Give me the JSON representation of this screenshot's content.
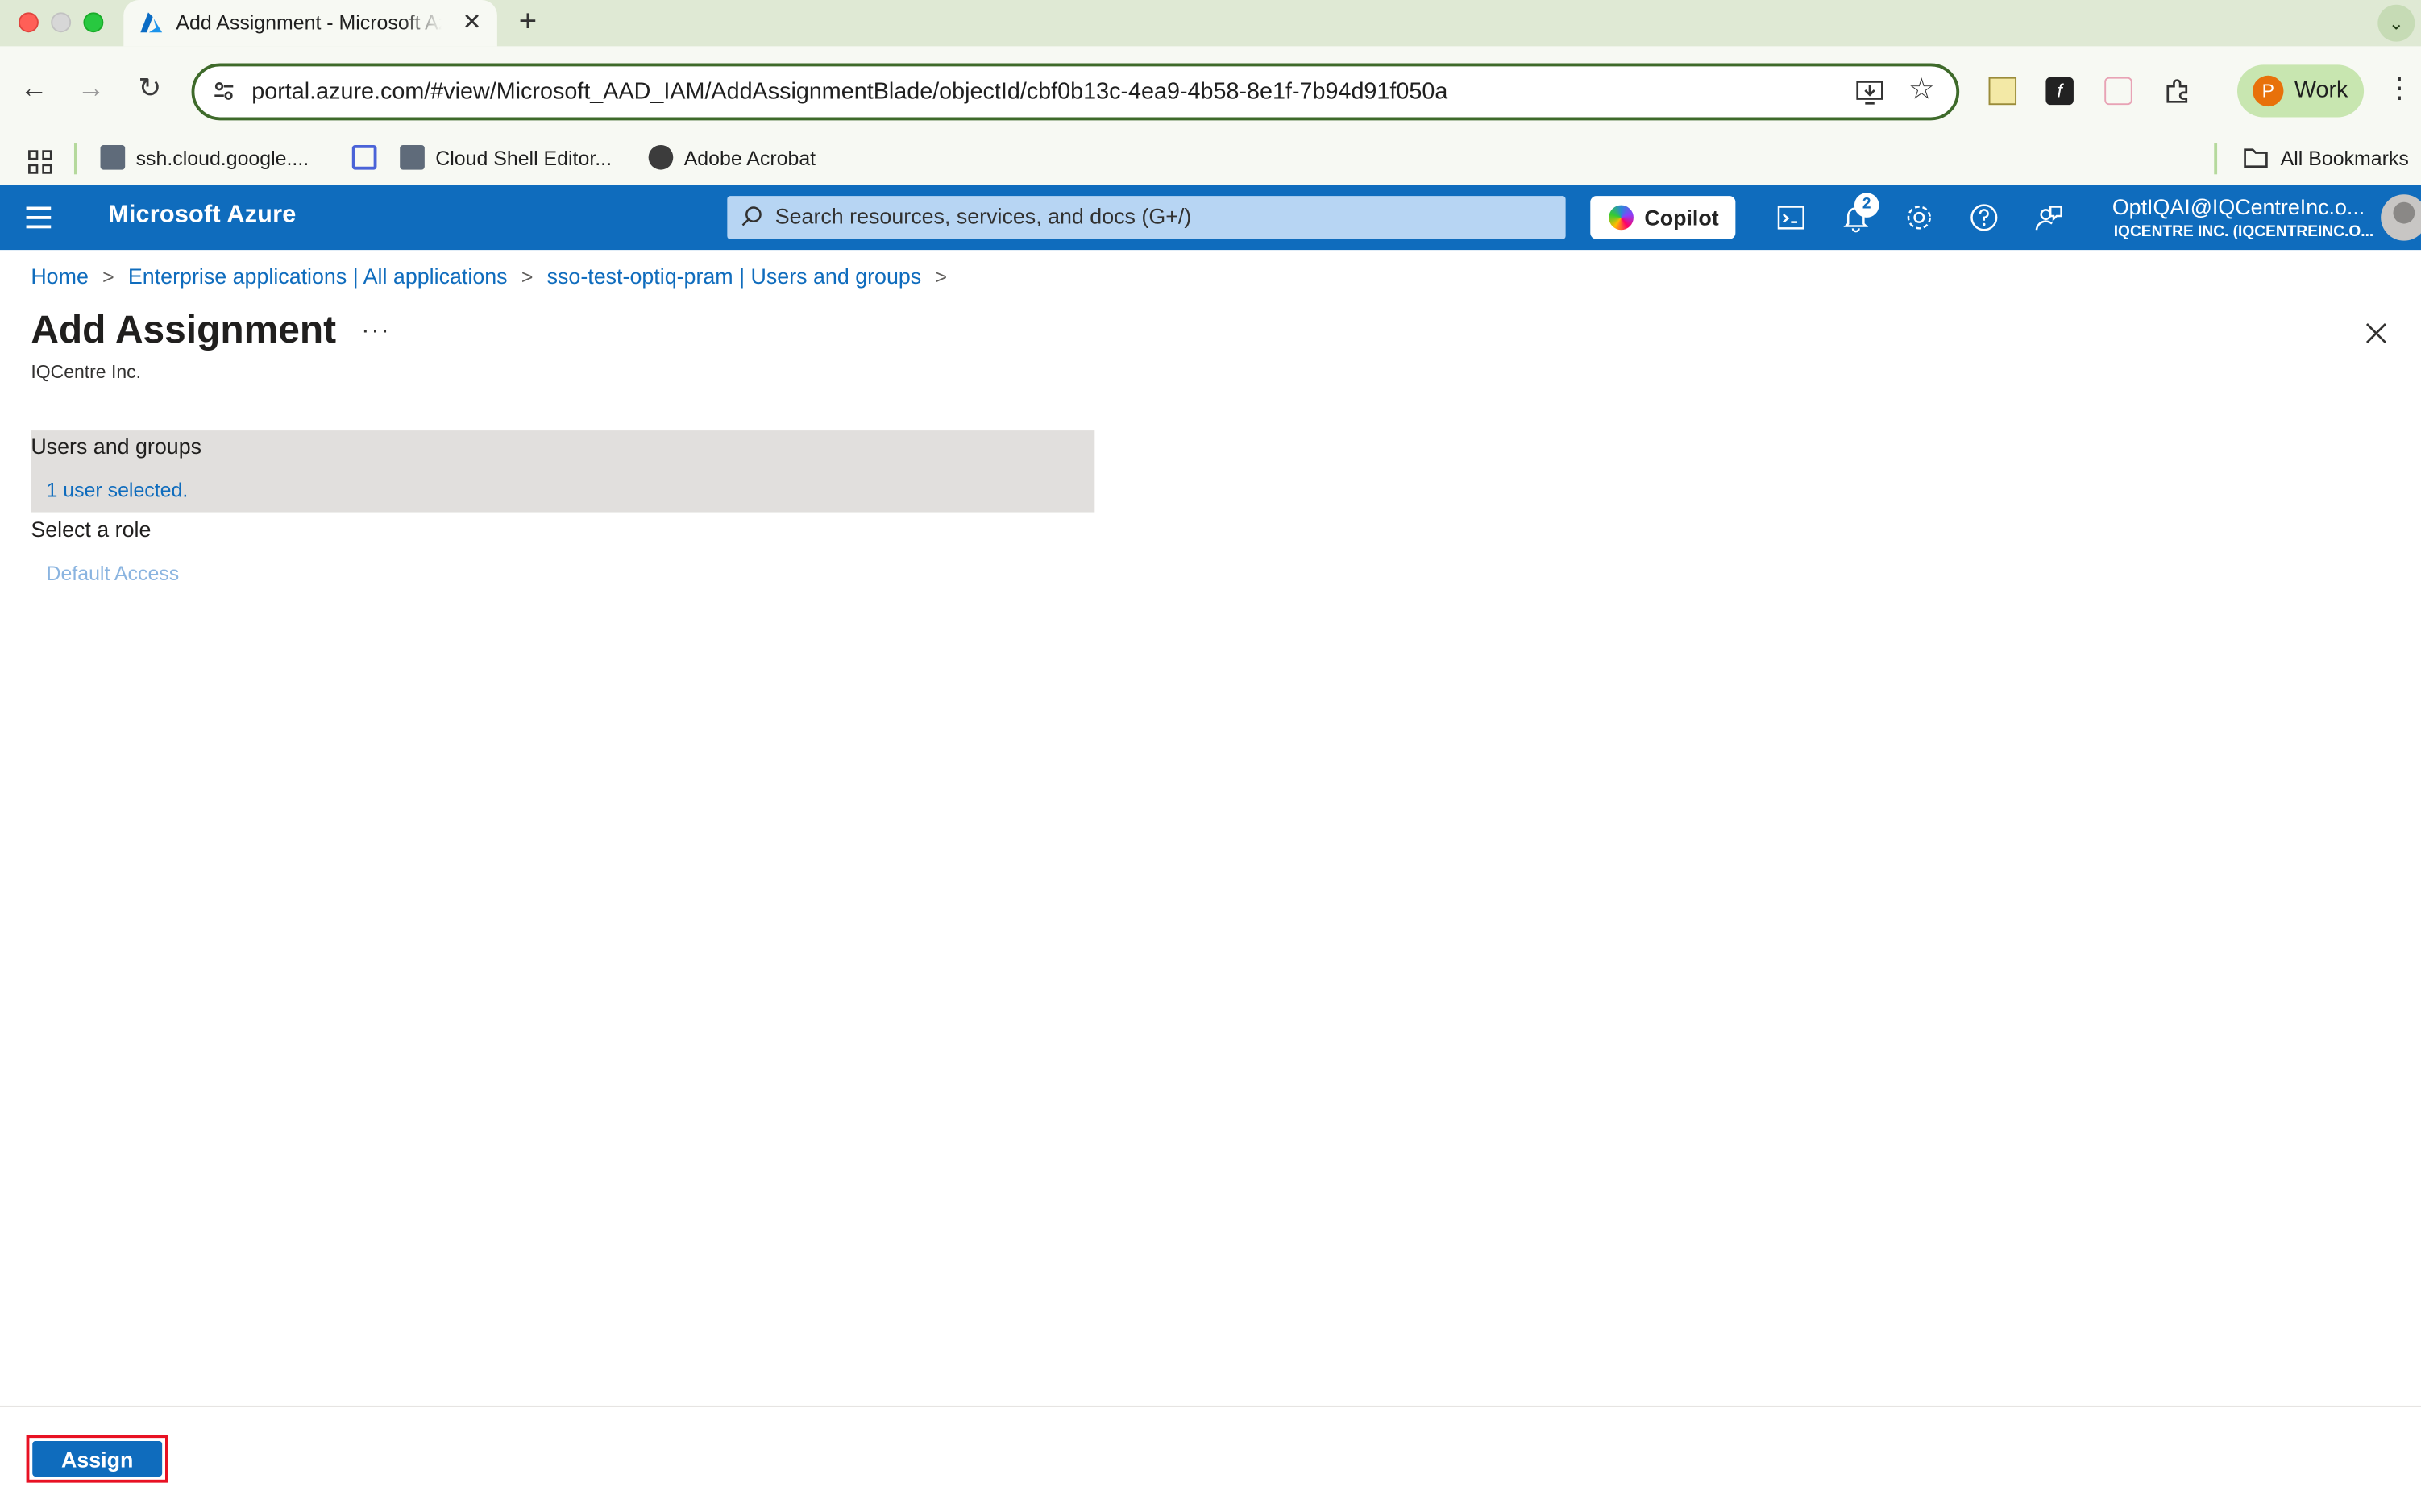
{
  "browser": {
    "tab_title": "Add Assignment - Microsoft Azure",
    "url": "portal.azure.com/#view/Microsoft_AAD_IAM/AddAssignmentBlade/objectId/cbf0b13c-4ea9-4b58-8e1f-7b94d91f050a",
    "profile_initial": "P",
    "profile_label": "Work",
    "bookmarks": [
      {
        "label": "ssh.cloud.google...."
      },
      {
        "label": ""
      },
      {
        "label": "Cloud Shell Editor..."
      },
      {
        "label": "Adobe Acrobat"
      }
    ],
    "all_bookmarks": "All Bookmarks"
  },
  "azure_header": {
    "brand": "Microsoft Azure",
    "search_placeholder": "Search resources, services, and docs (G+/)",
    "copilot_label": "Copilot",
    "notification_count": "2",
    "account_name": "OptIQAI@IQCentreInc.o...",
    "account_tenant": "IQCENTRE INC. (IQCENTREINC.O..."
  },
  "breadcrumb": [
    "Home",
    "Enterprise applications | All applications",
    "sso-test-optiq-pram | Users and groups"
  ],
  "page": {
    "title": "Add Assignment",
    "subtitle": "IQCentre Inc.",
    "users_groups_heading": "Users and groups",
    "users_selected": "1 user selected.",
    "role_heading": "Select a role",
    "role_value": "Default Access",
    "assign_label": "Assign"
  },
  "colors": {
    "azure_blue": "#0f6cbd",
    "focus_red": "#e81123",
    "panel_gray": "#e1dfdd"
  }
}
